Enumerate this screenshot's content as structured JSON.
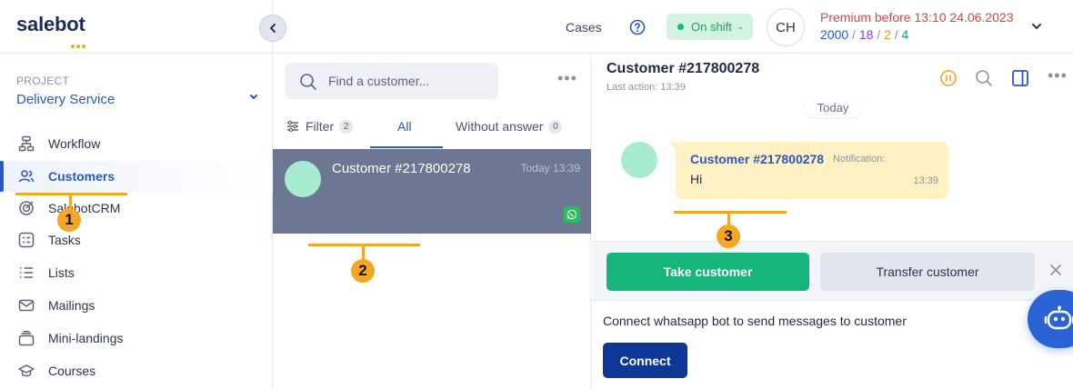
{
  "app": {
    "logo": "salebot",
    "colors": {
      "brand": "#1c2c5a",
      "accent": "#2a57c9",
      "take": "#17b57a",
      "connect": "#0f3896",
      "annotation": "#f5a623"
    }
  },
  "sidebar": {
    "project_label": "PROJECT",
    "project_name": "Delivery Service",
    "items": [
      {
        "label": "Workflow",
        "icon": "workflow-icon"
      },
      {
        "label": "Customers",
        "icon": "users-icon",
        "active": true
      },
      {
        "label": "SalebotCRM",
        "icon": "target-icon"
      },
      {
        "label": "Tasks",
        "icon": "tasks-icon"
      },
      {
        "label": "Lists",
        "icon": "list-icon"
      },
      {
        "label": "Mailings",
        "icon": "mail-icon"
      },
      {
        "label": "Mini-landings",
        "icon": "layers-icon"
      },
      {
        "label": "Courses",
        "icon": "graduation-cap-icon"
      }
    ]
  },
  "topbar": {
    "cases": "Cases",
    "shift_status": "On shift",
    "avatar_initials": "CH",
    "premium": "Premium before 13:10 24.06.2023",
    "limits": {
      "a": "2000",
      "b": "18",
      "c": "2",
      "d": "4",
      "sep": "/"
    }
  },
  "customers": {
    "search_placeholder": "Find a customer...",
    "tabs": {
      "filter": {
        "label": "Filter",
        "count": "2"
      },
      "all": {
        "label": "All"
      },
      "without_answer": {
        "label": "Without answer",
        "count": "0"
      }
    },
    "rows": [
      {
        "name": "Customer #217800278",
        "time": "Today 13:39",
        "channel": "whatsapp-icon"
      }
    ]
  },
  "chat": {
    "title": "Customer #217800278",
    "last_action_label": "Last action:",
    "last_action_time": "13:39",
    "day_divider": "Today",
    "message": {
      "from": "Customer #217800278",
      "kind": "Notification:",
      "text": "Hi",
      "time": "13:39"
    },
    "take_button": "Take customer",
    "transfer_button": "Transfer customer",
    "connect_text": "Connect whatsapp bot to send messages to customer",
    "connect_button": "Connect"
  },
  "annotations": {
    "one": "1",
    "two": "2",
    "three": "3"
  }
}
